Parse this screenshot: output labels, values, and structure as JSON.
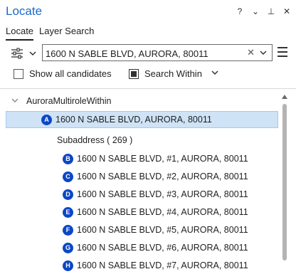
{
  "window": {
    "title": "Locate",
    "controls": [
      "?",
      "⌄",
      "⊥",
      "✕"
    ]
  },
  "tabs": [
    {
      "label": "Locate",
      "active": true
    },
    {
      "label": "Layer Search",
      "active": false
    }
  ],
  "search": {
    "value": "1600 N SABLE BLVD, AURORA, 80011",
    "clear_glyph": "✕",
    "dropdown_glyph": "▼"
  },
  "options": {
    "show_all_candidates": {
      "label": "Show all candidates",
      "checked": false
    },
    "search_within": {
      "label": "Search Within",
      "checked": true
    }
  },
  "results": {
    "group_label": "AuroraMultiroleWithin",
    "top_candidate": {
      "badge": "A",
      "text": "1600 N SABLE BLVD, AURORA, 80011"
    },
    "subaddress_label": "Subaddress ( 269 )",
    "subaddresses": [
      {
        "badge": "B",
        "text": "1600 N SABLE BLVD, #1, AURORA, 80011"
      },
      {
        "badge": "C",
        "text": "1600 N SABLE BLVD, #2, AURORA, 80011"
      },
      {
        "badge": "D",
        "text": "1600 N SABLE BLVD, #3, AURORA, 80011"
      },
      {
        "badge": "E",
        "text": "1600 N SABLE BLVD, #4, AURORA, 80011"
      },
      {
        "badge": "F",
        "text": "1600 N SABLE BLVD, #5, AURORA, 80011"
      },
      {
        "badge": "G",
        "text": "1600 N SABLE BLVD, #6, AURORA, 80011"
      },
      {
        "badge": "H",
        "text": "1600 N SABLE BLVD, #7, AURORA, 80011"
      }
    ]
  },
  "colors": {
    "title": "#1b6ac9",
    "badge": "#0b47c7",
    "selection": "#cfe3f6"
  }
}
